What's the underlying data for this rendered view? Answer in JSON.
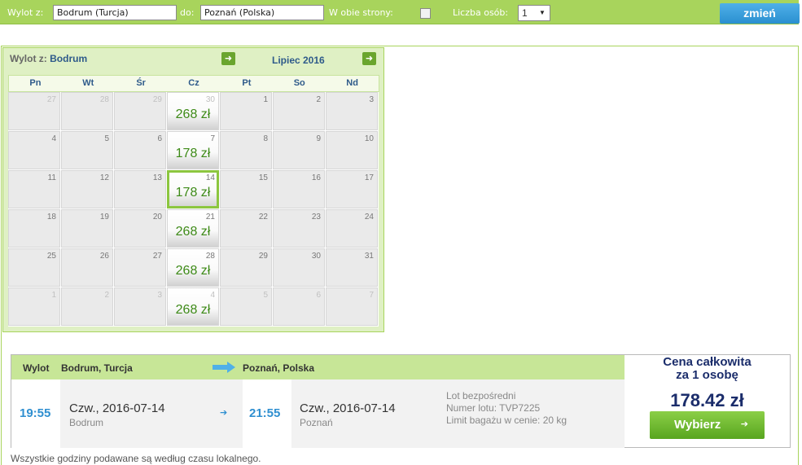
{
  "search": {
    "from_label": "Wylot z:",
    "from_value": "Bodrum (Turcja)",
    "to_label": "do:",
    "to_value": "Poznań (Polska)",
    "roundtrip_label": "W obie strony:",
    "roundtrip_checked": false,
    "persons_label": "Liczba osób:",
    "persons_value": "1",
    "submit_label": "zmień"
  },
  "calendar": {
    "from_label": "Wylot z:",
    "from_city": "Bodrum",
    "month": "Lipiec 2016",
    "weekdays": [
      "Pn",
      "Wt",
      "Śr",
      "Cz",
      "Pt",
      "So",
      "Nd"
    ],
    "weeks": [
      [
        {
          "d": "27",
          "o": true
        },
        {
          "d": "28",
          "o": true
        },
        {
          "d": "29",
          "o": true
        },
        {
          "d": "30",
          "o": true,
          "p": "268 zł"
        },
        {
          "d": "1"
        },
        {
          "d": "2"
        },
        {
          "d": "3"
        }
      ],
      [
        {
          "d": "4"
        },
        {
          "d": "5"
        },
        {
          "d": "6"
        },
        {
          "d": "7",
          "p": "178 zł"
        },
        {
          "d": "8"
        },
        {
          "d": "9"
        },
        {
          "d": "10"
        }
      ],
      [
        {
          "d": "11"
        },
        {
          "d": "12"
        },
        {
          "d": "13"
        },
        {
          "d": "14",
          "p": "178 zł",
          "s": true
        },
        {
          "d": "15"
        },
        {
          "d": "16"
        },
        {
          "d": "17"
        }
      ],
      [
        {
          "d": "18"
        },
        {
          "d": "19"
        },
        {
          "d": "20"
        },
        {
          "d": "21",
          "p": "268 zł"
        },
        {
          "d": "22"
        },
        {
          "d": "23"
        },
        {
          "d": "24"
        }
      ],
      [
        {
          "d": "25"
        },
        {
          "d": "26"
        },
        {
          "d": "27"
        },
        {
          "d": "28",
          "p": "268 zł"
        },
        {
          "d": "29"
        },
        {
          "d": "30"
        },
        {
          "d": "31"
        }
      ],
      [
        {
          "d": "1",
          "o": true
        },
        {
          "d": "2",
          "o": true
        },
        {
          "d": "3",
          "o": true
        },
        {
          "d": "4",
          "o": true,
          "p": "268 zł"
        },
        {
          "d": "5",
          "o": true
        },
        {
          "d": "6",
          "o": true
        },
        {
          "d": "7",
          "o": true
        }
      ]
    ]
  },
  "flight": {
    "header_label": "Wylot",
    "origin": "Bodrum, Turcja",
    "destination": "Poznań, Polska",
    "dep_time": "19:55",
    "dep_date": "Czw., 2016-07-14",
    "dep_city": "Bodrum",
    "arr_time": "21:55",
    "arr_date": "Czw., 2016-07-14",
    "arr_city": "Poznań",
    "info_direct": "Lot bezpośredni",
    "info_number": "Numer lotu: TVP7225",
    "info_baggage": "Limit bagażu w cenie: 20 kg",
    "total_title_1": "Cena całkowita",
    "total_title_2": "za 1 osobę",
    "total_price": "178.42 zł",
    "select_label": "Wybierz"
  },
  "footnote": "Wszystkie godziny podawane są według czasu lokalnego.",
  "colors": {
    "accent_green": "#a8d45c",
    "price_green": "#3d8a17",
    "time_blue": "#2f8fd0",
    "title_navy": "#1b2d6b",
    "button_blue": "#2a8fd0"
  }
}
